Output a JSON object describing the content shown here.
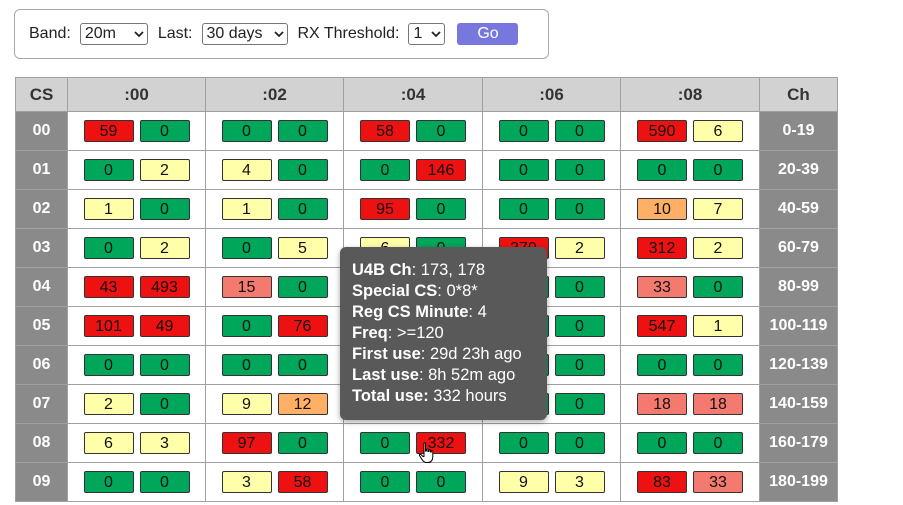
{
  "controls": {
    "band_label": "Band:",
    "band_value": "20m",
    "last_label": "Last:",
    "last_value": "30 days",
    "rx_label": "RX Threshold:",
    "rx_value": "1",
    "go_label": "Go"
  },
  "table": {
    "headers": [
      "CS",
      ":00",
      ":02",
      ":04",
      ":06",
      ":08",
      "Ch"
    ],
    "rows": [
      {
        "cs": "00",
        "ch": "0-19",
        "cells": [
          [
            "59",
            "red"
          ],
          [
            "0",
            "green"
          ],
          [
            "0",
            "green"
          ],
          [
            "0",
            "green"
          ],
          [
            "58",
            "red"
          ],
          [
            "0",
            "green"
          ],
          [
            "0",
            "green"
          ],
          [
            "0",
            "green"
          ],
          [
            "590",
            "red"
          ],
          [
            "6",
            "yellow"
          ]
        ]
      },
      {
        "cs": "01",
        "ch": "20-39",
        "cells": [
          [
            "0",
            "green"
          ],
          [
            "2",
            "yellow"
          ],
          [
            "4",
            "yellow"
          ],
          [
            "0",
            "green"
          ],
          [
            "0",
            "green"
          ],
          [
            "146",
            "red"
          ],
          [
            "0",
            "green"
          ],
          [
            "0",
            "green"
          ],
          [
            "0",
            "green"
          ],
          [
            "0",
            "green"
          ]
        ]
      },
      {
        "cs": "02",
        "ch": "40-59",
        "cells": [
          [
            "1",
            "yellow"
          ],
          [
            "0",
            "green"
          ],
          [
            "1",
            "yellow"
          ],
          [
            "0",
            "green"
          ],
          [
            "95",
            "red"
          ],
          [
            "0",
            "green"
          ],
          [
            "0",
            "green"
          ],
          [
            "0",
            "green"
          ],
          [
            "10",
            "orange"
          ],
          [
            "7",
            "yellow"
          ]
        ]
      },
      {
        "cs": "03",
        "ch": "60-79",
        "cells": [
          [
            "0",
            "green"
          ],
          [
            "2",
            "yellow"
          ],
          [
            "0",
            "green"
          ],
          [
            "5",
            "yellow"
          ],
          [
            "6",
            "yellow"
          ],
          [
            "0",
            "green"
          ],
          [
            "379",
            "red"
          ],
          [
            "2",
            "yellow"
          ],
          [
            "312",
            "red"
          ],
          [
            "2",
            "yellow"
          ]
        ]
      },
      {
        "cs": "04",
        "ch": "80-99",
        "cells": [
          [
            "43",
            "red"
          ],
          [
            "493",
            "red"
          ],
          [
            "15",
            "pink"
          ],
          [
            "0",
            "green"
          ],
          [
            "",
            "green"
          ],
          [
            "",
            "green"
          ],
          [
            "",
            "green"
          ],
          [
            "0",
            "green"
          ],
          [
            "33",
            "pink"
          ],
          [
            "0",
            "green"
          ]
        ]
      },
      {
        "cs": "05",
        "ch": "100-119",
        "cells": [
          [
            "101",
            "red"
          ],
          [
            "49",
            "red"
          ],
          [
            "0",
            "green"
          ],
          [
            "76",
            "red"
          ],
          [
            "",
            "green"
          ],
          [
            "",
            "green"
          ],
          [
            "",
            "green"
          ],
          [
            "0",
            "green"
          ],
          [
            "547",
            "red"
          ],
          [
            "1",
            "yellow"
          ]
        ]
      },
      {
        "cs": "06",
        "ch": "120-139",
        "cells": [
          [
            "0",
            "green"
          ],
          [
            "0",
            "green"
          ],
          [
            "0",
            "green"
          ],
          [
            "0",
            "green"
          ],
          [
            "",
            "green"
          ],
          [
            "",
            "green"
          ],
          [
            "",
            "green"
          ],
          [
            "0",
            "green"
          ],
          [
            "0",
            "green"
          ],
          [
            "0",
            "green"
          ]
        ]
      },
      {
        "cs": "07",
        "ch": "140-159",
        "cells": [
          [
            "2",
            "yellow"
          ],
          [
            "0",
            "green"
          ],
          [
            "9",
            "yellow"
          ],
          [
            "12",
            "orange"
          ],
          [
            "",
            "green"
          ],
          [
            "",
            "green"
          ],
          [
            "",
            "green"
          ],
          [
            "0",
            "green"
          ],
          [
            "18",
            "pink"
          ],
          [
            "18",
            "pink"
          ]
        ]
      },
      {
        "cs": "08",
        "ch": "160-179",
        "cells": [
          [
            "6",
            "yellow"
          ],
          [
            "3",
            "yellow"
          ],
          [
            "97",
            "red"
          ],
          [
            "0",
            "green"
          ],
          [
            "0",
            "green"
          ],
          [
            "332",
            "red"
          ],
          [
            "0",
            "green"
          ],
          [
            "0",
            "green"
          ],
          [
            "0",
            "green"
          ],
          [
            "0",
            "green"
          ]
        ]
      },
      {
        "cs": "09",
        "ch": "180-199",
        "cells": [
          [
            "0",
            "green"
          ],
          [
            "0",
            "green"
          ],
          [
            "3",
            "yellow"
          ],
          [
            "58",
            "red"
          ],
          [
            "0",
            "green"
          ],
          [
            "0",
            "green"
          ],
          [
            "9",
            "yellow"
          ],
          [
            "3",
            "yellow"
          ],
          [
            "83",
            "red"
          ],
          [
            "33",
            "pink"
          ]
        ]
      }
    ]
  },
  "tooltip": {
    "lines": [
      {
        "label": "U4B Ch",
        "value": ": 173, 178"
      },
      {
        "label": "Special CS",
        "value": ": 0*8*"
      },
      {
        "label": "Reg CS Minute",
        "value": ": 4"
      },
      {
        "label": "Freq",
        "value": ": >=120"
      },
      {
        "label": "First use",
        "value": ": 29d 23h ago"
      },
      {
        "label": "Last use",
        "value": ": 8h 52m ago"
      },
      {
        "label": "Total use:",
        "value": " 332 hours"
      }
    ]
  },
  "colors": {
    "green": "#00a65a",
    "red": "#ee1111",
    "yellow": "#ffffaa",
    "orange": "#ffb066",
    "pink": "#f47a70",
    "header": "#d2d2d2",
    "label_col": "#8a8a8a",
    "go": "#7777dd"
  }
}
